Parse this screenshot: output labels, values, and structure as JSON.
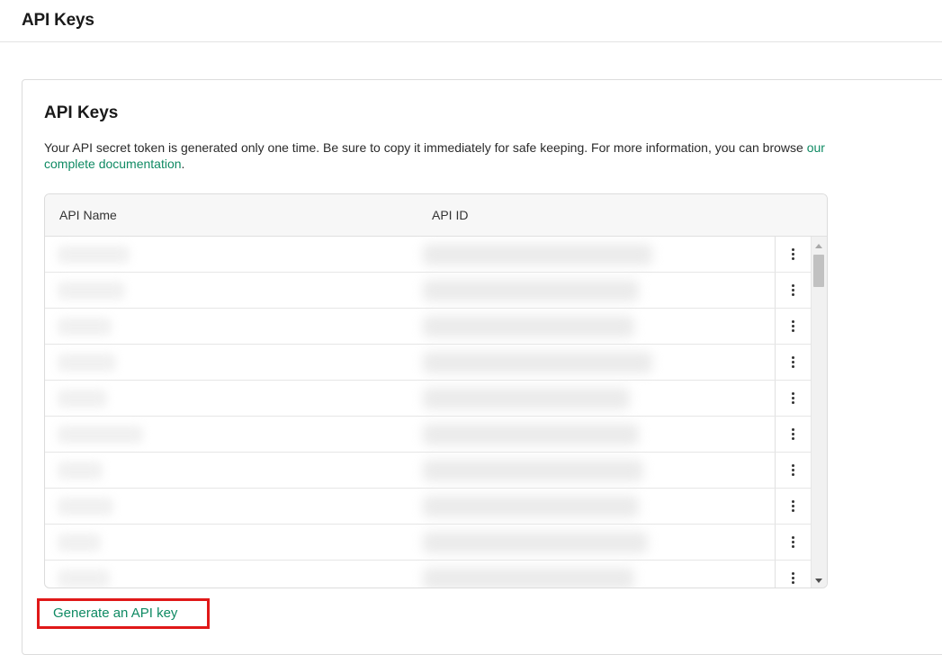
{
  "header": {
    "title": "API Keys"
  },
  "card": {
    "title": "API Keys",
    "description": "Your API secret token is generated only one time. Be sure to copy it immediately for safe keeping. For more information, you can browse ",
    "doc_link_label": "our complete documentation",
    "description_end": "."
  },
  "table": {
    "columns": [
      "API Name",
      "API ID"
    ],
    "rows": [
      {
        "name": "",
        "id": ""
      },
      {
        "name": "",
        "id": ""
      },
      {
        "name": "",
        "id": ""
      },
      {
        "name": "",
        "id": ""
      },
      {
        "name": "",
        "id": ""
      },
      {
        "name": "",
        "id": ""
      },
      {
        "name": "",
        "id": ""
      },
      {
        "name": "",
        "id": ""
      },
      {
        "name": "",
        "id": ""
      },
      {
        "name": "",
        "id": ""
      }
    ],
    "row_menu_icon": "kebab-menu-icon"
  },
  "actions": {
    "generate_label": "Generate an API key"
  },
  "colors": {
    "accent": "#0f8a63",
    "highlight_border": "#e01818"
  }
}
